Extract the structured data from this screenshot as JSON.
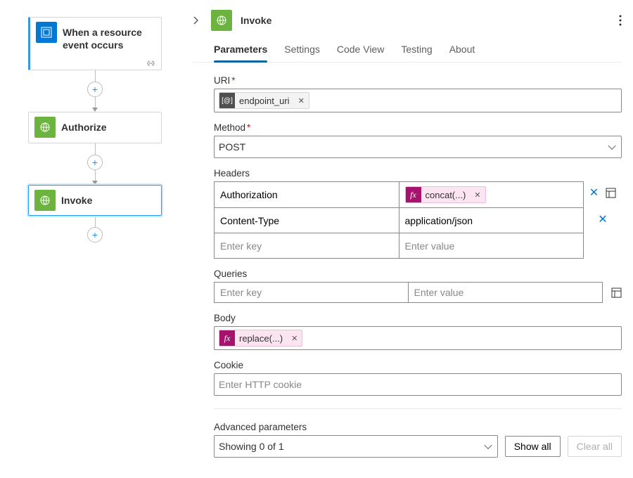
{
  "flow": {
    "nodes": [
      {
        "label": "When a resource event occurs",
        "kind": "trigger"
      },
      {
        "label": "Authorize",
        "kind": "action"
      },
      {
        "label": "Invoke",
        "kind": "action"
      }
    ]
  },
  "panel": {
    "title": "Invoke",
    "tabs": [
      "Parameters",
      "Settings",
      "Code View",
      "Testing",
      "About"
    ],
    "active_tab": 0,
    "labels": {
      "uri": "URI",
      "method": "Method",
      "headers": "Headers",
      "queries": "Queries",
      "body": "Body",
      "cookie": "Cookie",
      "advanced": "Advanced parameters"
    },
    "uri_token": "endpoint_uri",
    "method_value": "POST",
    "headers": [
      {
        "key": "Authorization",
        "value_type": "fx",
        "value_token": "concat(...)"
      },
      {
        "key": "Content-Type",
        "value_type": "text",
        "value": "application/json"
      }
    ],
    "placeholders": {
      "enter_key": "Enter key",
      "enter_value": "Enter value",
      "cookie": "Enter HTTP cookie"
    },
    "body_token": "replace(...)",
    "advanced_dropdown": "Showing 0 of 1",
    "buttons": {
      "show_all": "Show all",
      "clear_all": "Clear all"
    }
  }
}
